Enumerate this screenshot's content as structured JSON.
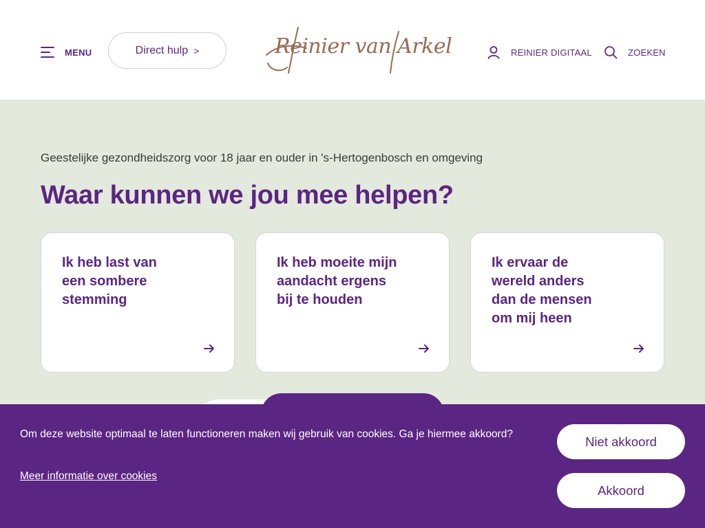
{
  "header": {
    "menu_label": "MENU",
    "direct_hulp_label": "Direct hulp",
    "direct_hulp_chevron": ">",
    "logo_text": "Reinier van Arkel",
    "digitaal_label": "REINIER DIGITAAL",
    "zoeken_label": "ZOEKEN",
    "icons": [
      "menu-icon",
      "user-icon",
      "search-icon"
    ]
  },
  "hero": {
    "tagline": "Geestelijke gezondheidszorg voor 18 jaar en ouder in 's-Hertogenbosch en omgeving",
    "headline": "Waar kunnen we jou mee helpen?",
    "cards": [
      {
        "title": "Ik heb last van een sombere stemming"
      },
      {
        "title": "Ik heb moeite mijn aandacht ergens bij te houden"
      },
      {
        "title": "Ik ervaar de wereld anders dan de mensen om mij heen"
      }
    ]
  },
  "cookie": {
    "text": "Om deze website optimaal te laten functioneren maken wij gebruik van cookies. Ga je hiermee akkoord?",
    "link": "Meer informatie over cookies",
    "decline_label": "Niet akkoord",
    "accept_label": "Akkoord"
  },
  "colors": {
    "brand_purple": "#5b2583",
    "hero_background": "#e3e9dc",
    "logo_brown": "#9a6a52"
  }
}
